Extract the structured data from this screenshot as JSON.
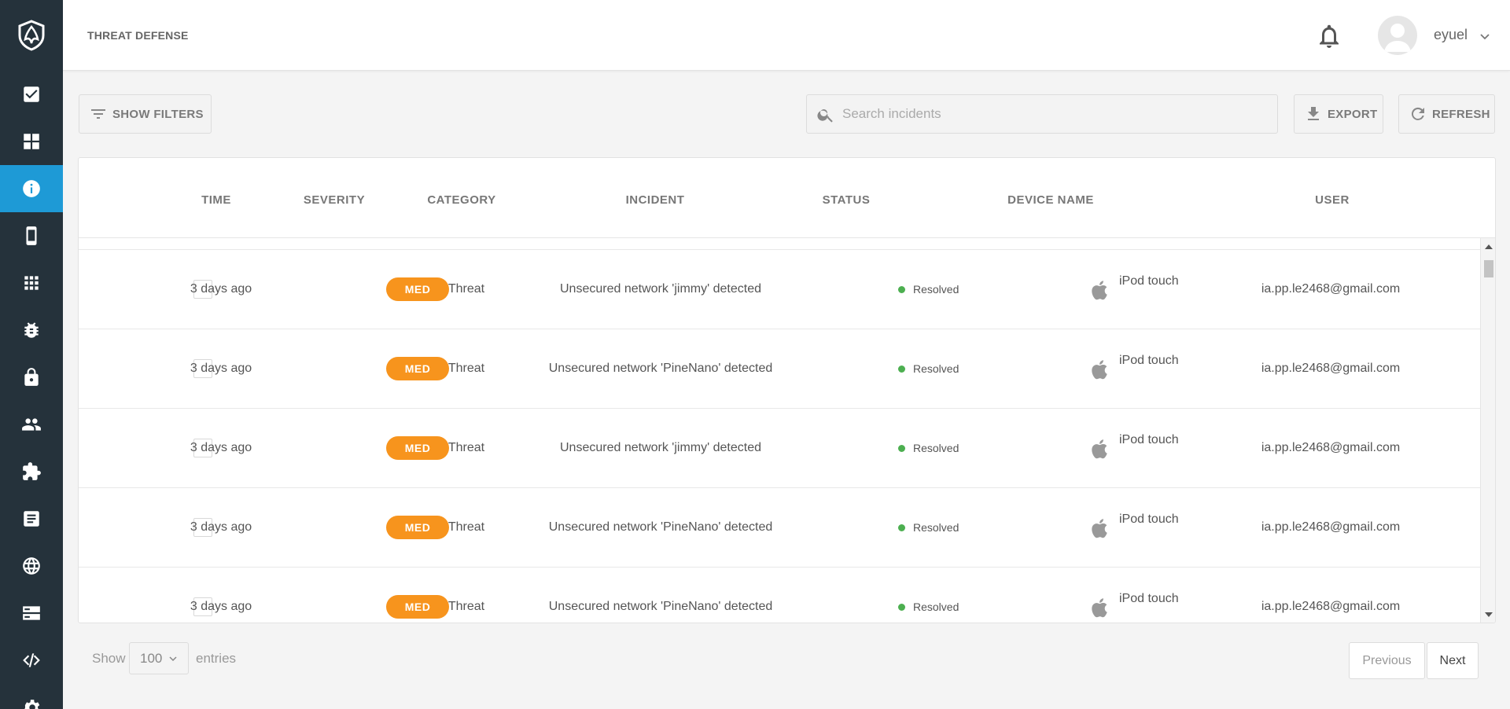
{
  "header": {
    "title": "THREAT DEFENSE",
    "username": "eyuel"
  },
  "sidebar": {
    "items": [
      {
        "icon": "checkbox-icon",
        "active": false
      },
      {
        "icon": "dashboard-grid-icon",
        "active": false
      },
      {
        "icon": "info-icon",
        "active": true
      },
      {
        "icon": "mobile-device-icon",
        "active": false
      },
      {
        "icon": "apps-grid-icon",
        "active": false
      },
      {
        "icon": "bug-icon",
        "active": false
      },
      {
        "icon": "lock-icon",
        "active": false
      },
      {
        "icon": "users-icon",
        "active": false
      },
      {
        "icon": "puzzle-icon",
        "active": false
      },
      {
        "icon": "document-icon",
        "active": false
      },
      {
        "icon": "globe-icon",
        "active": false
      },
      {
        "icon": "server-icon",
        "active": false
      },
      {
        "icon": "code-icon",
        "active": false
      },
      {
        "icon": "settings-icon",
        "active": false
      }
    ]
  },
  "toolbar": {
    "show_filters": "SHOW FILTERS",
    "search_placeholder": "Search incidents",
    "export": "EXPORT",
    "refresh": "REFRESH"
  },
  "table": {
    "columns": [
      "TIME",
      "SEVERITY",
      "CATEGORY",
      "INCIDENT",
      "STATUS",
      "DEVICE NAME",
      "USER"
    ],
    "rows": [
      {
        "time": "3 days ago",
        "severity": "MED",
        "category": "Threat",
        "incident": "Unsecured network 'jimmy' detected",
        "status": "Resolved",
        "device": "iPod touch",
        "user": "ia.pp.le2468@gmail.com"
      },
      {
        "time": "3 days ago",
        "severity": "MED",
        "category": "Threat",
        "incident": "Unsecured network 'PineNano' detected",
        "status": "Resolved",
        "device": "iPod touch",
        "user": "ia.pp.le2468@gmail.com"
      },
      {
        "time": "3 days ago",
        "severity": "MED",
        "category": "Threat",
        "incident": "Unsecured network 'jimmy' detected",
        "status": "Resolved",
        "device": "iPod touch",
        "user": "ia.pp.le2468@gmail.com"
      },
      {
        "time": "3 days ago",
        "severity": "MED",
        "category": "Threat",
        "incident": "Unsecured network 'PineNano' detected",
        "status": "Resolved",
        "device": "iPod touch",
        "user": "ia.pp.le2468@gmail.com"
      },
      {
        "time": "3 days ago",
        "severity": "MED",
        "category": "Threat",
        "incident": "Unsecured network 'PineNano' detected",
        "status": "Resolved",
        "device": "iPod touch",
        "user": "ia.pp.le2468@gmail.com"
      }
    ]
  },
  "footer": {
    "show_label": "Show",
    "page_size": "100",
    "entries_label": "entries",
    "previous": "Previous",
    "next": "Next"
  },
  "colors": {
    "accent": "#1e9ad6",
    "sidebar": "#25323b",
    "severity_med": "#f7941d",
    "status_resolved": "#4caf50"
  }
}
